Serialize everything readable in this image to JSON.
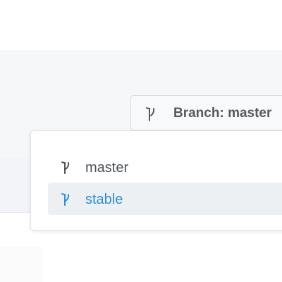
{
  "branch_selector": {
    "button_label": "Branch: master",
    "icon": "branch-icon"
  },
  "branch_menu": {
    "items": [
      {
        "label": "master",
        "icon": "branch-icon",
        "active": false
      },
      {
        "label": "stable",
        "icon": "branch-icon",
        "active": true
      }
    ]
  },
  "colors": {
    "active_item_text": "#2f8fd6",
    "active_item_background": "#edf0f3",
    "default_item_text": "#4e5359",
    "button_text": "#555a60"
  }
}
